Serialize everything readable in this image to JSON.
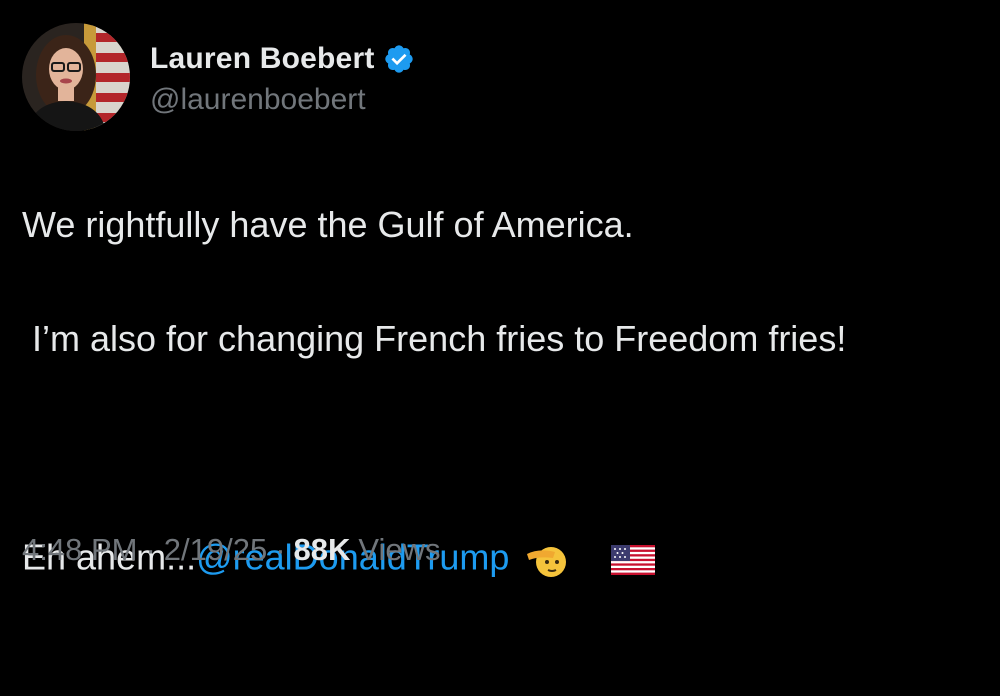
{
  "author": {
    "display_name": "Lauren Boebert",
    "handle": "@laurenboebert",
    "verified_icon": "verified-badge-icon",
    "avatar_icon": "profile-photo"
  },
  "tweet": {
    "line1": "We rightfully have the Gulf of America.",
    "line2": " I’m also for changing French fries to Freedom fries!",
    "line3_prefix": "Eh ahem...",
    "mention": "@realDonaldTrump",
    "emojis": [
      "saluting-face-icon",
      "us-flag-icon"
    ]
  },
  "meta": {
    "time": "4:48 PM",
    "separator": "·",
    "date": "2/19/25",
    "views_count": "88K",
    "views_label": "Views"
  },
  "colors": {
    "background": "#000000",
    "primary_text": "#e7e9ea",
    "secondary_text": "#71767b",
    "link": "#1d9bf0",
    "verified": "#1d9bf0"
  }
}
